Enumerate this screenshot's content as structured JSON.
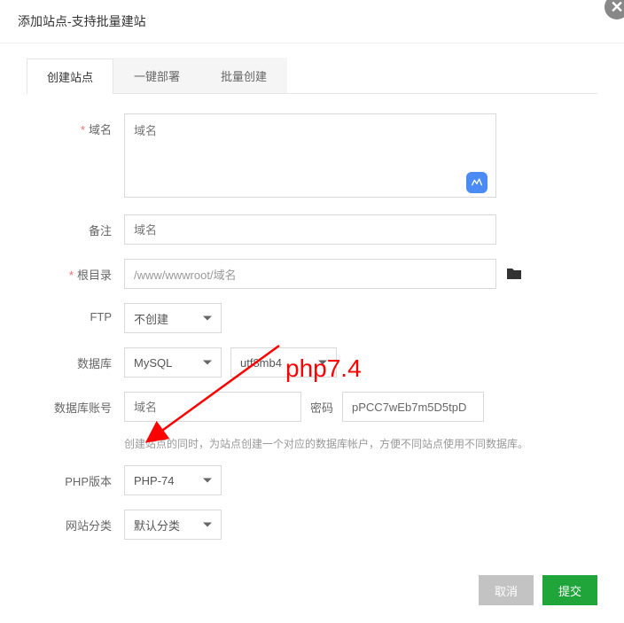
{
  "modal": {
    "title": "添加站点-支持批量建站"
  },
  "tabs": {
    "items": [
      {
        "label": "创建站点"
      },
      {
        "label": "一键部署"
      },
      {
        "label": "批量创建"
      }
    ]
  },
  "form": {
    "domain": {
      "label": "域名",
      "placeholder": "域名"
    },
    "remark": {
      "label": "备注",
      "placeholder": "域名"
    },
    "root": {
      "label": "根目录",
      "value": "/www/wwwroot/域名"
    },
    "ftp": {
      "label": "FTP",
      "value": "不创建"
    },
    "database": {
      "label": "数据库",
      "type": "MySQL",
      "charset": "utf8mb4"
    },
    "db_account": {
      "label": "数据库账号",
      "user_placeholder": "域名",
      "pwd_label": "密码",
      "pwd_value": "pPCC7wEb7m5D5tpD",
      "help": "创建站点的同时，为站点创建一个对应的数据库帐户，方便不同站点使用不同数据库。"
    },
    "php": {
      "label": "PHP版本",
      "value": "PHP-74"
    },
    "category": {
      "label": "网站分类",
      "value": "默认分类"
    }
  },
  "footer": {
    "cancel": "取消",
    "submit": "提交"
  },
  "annotation": {
    "text": "php7.4"
  }
}
